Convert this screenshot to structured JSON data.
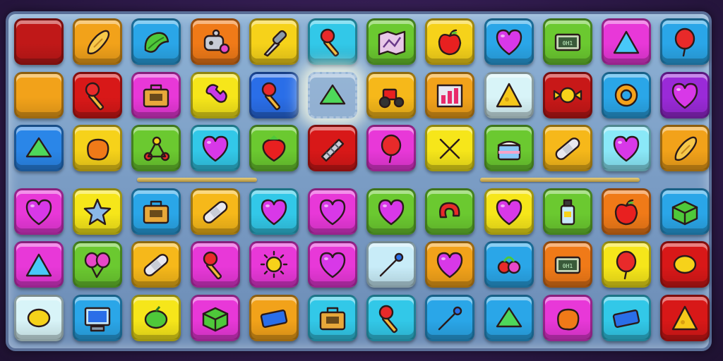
{
  "board": {
    "rows": 6,
    "cols": 12,
    "tiles": [
      [
        {
          "color": "#c01818",
          "icon": "blank-icon"
        },
        {
          "color": "#f2a21a",
          "icon": "bread-icon"
        },
        {
          "color": "#2aa6e8",
          "icon": "leaf-icon"
        },
        {
          "color": "#f07a18",
          "icon": "robot-icon"
        },
        {
          "color": "#f6d21a",
          "icon": "screwdriver-icon"
        },
        {
          "color": "#32c8e8",
          "icon": "hammer-icon"
        },
        {
          "color": "#6bc930",
          "icon": "map-icon"
        },
        {
          "color": "#f6d21a",
          "icon": "apple-icon"
        },
        {
          "color": "#2aa6e8",
          "icon": "heart-icon"
        },
        {
          "color": "#6bc930",
          "icon": "sign-icon"
        },
        {
          "color": "#e838d8",
          "icon": "triangle-icon"
        },
        {
          "color": "#2aa6e8",
          "icon": "balloon-icon"
        }
      ],
      [
        {
          "color": "#f2a21a",
          "icon": "blank-icon"
        },
        {
          "color": "#d81818",
          "icon": "hammer-icon"
        },
        {
          "color": "#e838d8",
          "icon": "briefcase-icon"
        },
        {
          "color": "#f6e61a",
          "icon": "wrench-icon"
        },
        {
          "color": "#2a6ee8",
          "icon": "hammer-icon"
        },
        {
          "color": "#ffffff",
          "icon": "gem-icon",
          "empty": true
        },
        {
          "color": "#f6b81a",
          "icon": "tractor-icon"
        },
        {
          "color": "#f2a21a",
          "icon": "chart-icon"
        },
        {
          "color": "#d8f4f8",
          "icon": "cheese-icon"
        },
        {
          "color": "#c81818",
          "icon": "candy-icon"
        },
        {
          "color": "#2aa6e8",
          "icon": "ring-icon"
        },
        {
          "color": "#9a2ad8",
          "icon": "heart-icon"
        }
      ],
      [
        {
          "color": "#2a86e8",
          "icon": "gem-icon"
        },
        {
          "color": "#f6d21a",
          "icon": "blob-icon"
        },
        {
          "color": "#6bc930",
          "icon": "pulley-icon"
        },
        {
          "color": "#32c8e8",
          "icon": "heart-icon"
        },
        {
          "color": "#6bc930",
          "icon": "strawberry-icon"
        },
        {
          "color": "#d81818",
          "icon": "spring-icon"
        },
        {
          "color": "#e838d8",
          "icon": "balloon-icon"
        },
        {
          "color": "#f6e61a",
          "icon": "tools-icon"
        },
        {
          "color": "#6bc930",
          "icon": "cake-icon"
        },
        {
          "color": "#f6b81a",
          "icon": "bandage-icon"
        },
        {
          "color": "#8ae8f8",
          "icon": "heart-icon"
        },
        {
          "color": "#f2a21a",
          "icon": "bread-icon"
        }
      ],
      [
        {
          "color": "#e838d8",
          "icon": "heart-icon"
        },
        {
          "color": "#f6e61a",
          "icon": "star-icon"
        },
        {
          "color": "#2aa6e8",
          "icon": "briefcase-icon"
        },
        {
          "color": "#f6b81a",
          "icon": "bandage-icon"
        },
        {
          "color": "#32c8e8",
          "icon": "heart-icon"
        },
        {
          "color": "#e838d8",
          "icon": "heart-icon"
        },
        {
          "color": "#6bc930",
          "icon": "heart-icon"
        },
        {
          "color": "#6bc930",
          "icon": "magnet-icon"
        },
        {
          "color": "#f6e61a",
          "icon": "heart-icon"
        },
        {
          "color": "#6bc930",
          "icon": "bottle-icon"
        },
        {
          "color": "#f07a18",
          "icon": "apple-icon"
        },
        {
          "color": "#2aa6e8",
          "icon": "box-icon"
        }
      ],
      [
        {
          "color": "#e838d8",
          "icon": "triangle-icon"
        },
        {
          "color": "#6bc930",
          "icon": "balloons-icon"
        },
        {
          "color": "#f6b81a",
          "icon": "bandage-icon"
        },
        {
          "color": "#e838d8",
          "icon": "hammer-icon"
        },
        {
          "color": "#e838d8",
          "icon": "sun-icon"
        },
        {
          "color": "#e838d8",
          "icon": "heart-icon"
        },
        {
          "color": "#c8ecf8",
          "icon": "pin-icon"
        },
        {
          "color": "#f2a21a",
          "icon": "heart-icon"
        },
        {
          "color": "#2aa6e8",
          "icon": "berries-icon"
        },
        {
          "color": "#f07a18",
          "icon": "sign-icon"
        },
        {
          "color": "#f6e61a",
          "icon": "balloon-icon"
        },
        {
          "color": "#d81818",
          "icon": "lemon-icon"
        }
      ],
      [
        {
          "color": "#d8f4f8",
          "icon": "lemon-icon"
        },
        {
          "color": "#2aa6e8",
          "icon": "computer-icon"
        },
        {
          "color": "#f6e61a",
          "icon": "lime-icon"
        },
        {
          "color": "#e838d8",
          "icon": "box-icon"
        },
        {
          "color": "#f2a21a",
          "icon": "eraser-icon"
        },
        {
          "color": "#32c8e8",
          "icon": "briefcase-icon"
        },
        {
          "color": "#32c8e8",
          "icon": "hammer-icon"
        },
        {
          "color": "#2aa6e8",
          "icon": "pin-icon"
        },
        {
          "color": "#2aa6e8",
          "icon": "gem-icon"
        },
        {
          "color": "#e838d8",
          "icon": "blob-icon"
        },
        {
          "color": "#32c8e8",
          "icon": "eraser-icon"
        },
        {
          "color": "#d81818",
          "icon": "cheese-icon"
        }
      ]
    ]
  }
}
